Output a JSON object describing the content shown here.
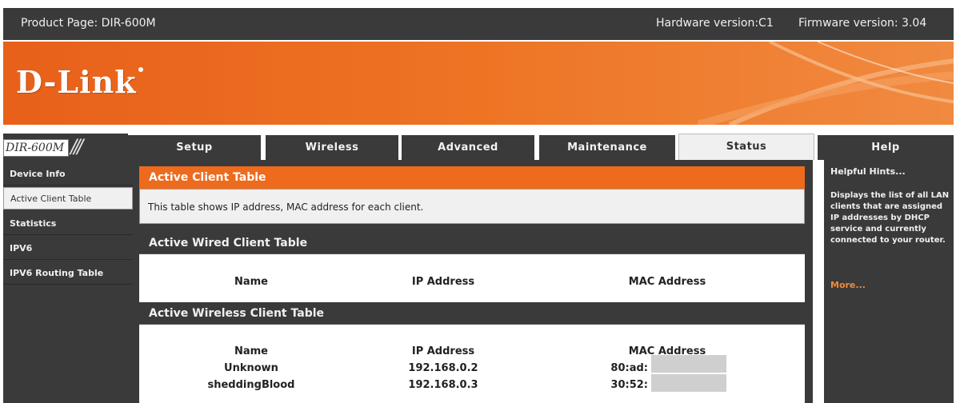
{
  "topbar": {
    "product": "Product Page: DIR-600M",
    "hardware": "Hardware version:C1",
    "firmware": "Firmware version: 3.04"
  },
  "brand": {
    "logo": "D-Link"
  },
  "model": {
    "label": "DIR-600M"
  },
  "tabs": [
    {
      "label": "Setup",
      "active": false
    },
    {
      "label": "Wireless",
      "active": false
    },
    {
      "label": "Advanced",
      "active": false
    },
    {
      "label": "Maintenance",
      "active": false
    },
    {
      "label": "Status",
      "active": true
    },
    {
      "label": "Help",
      "active": false
    }
  ],
  "sidebar": {
    "items": [
      {
        "label": "Device Info",
        "active": false
      },
      {
        "label": "Active Client Table",
        "active": true
      },
      {
        "label": "Statistics",
        "active": false
      },
      {
        "label": "IPV6",
        "active": false
      },
      {
        "label": "IPV6 Routing Table",
        "active": false
      }
    ]
  },
  "main": {
    "title": "Active Client Table",
    "description": "This table shows IP address, MAC address for each client.",
    "wired": {
      "title": "Active Wired Client Table",
      "columns": [
        "Name",
        "IP Address",
        "MAC Address"
      ]
    },
    "wireless": {
      "title": "Active Wireless Client Table",
      "columns": [
        "Name",
        "IP Address",
        "MAC Address"
      ],
      "rows": [
        {
          "name": "Unknown",
          "ip": "192.168.0.2",
          "mac": "80:ad:"
        },
        {
          "name": "sheddingBlood",
          "ip": "192.168.0.3",
          "mac": "30:52:"
        }
      ]
    }
  },
  "hints": {
    "title": "Helpful Hints...",
    "text": "Displays the list of all LAN clients that are assigned IP addresses by DHCP service and currently connected to your router.",
    "more": "More..."
  },
  "colors": {
    "accent": "#ee6a1c",
    "dark": "#3a3a3a",
    "panel": "#f0f0f0"
  }
}
